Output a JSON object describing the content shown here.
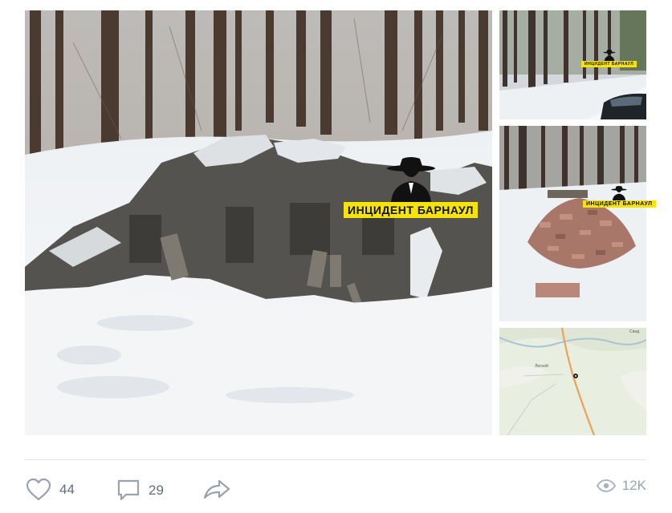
{
  "post": {
    "watermark_text": "ИНЦИДЕНТ БАРНАУЛ",
    "likes": "44",
    "comments": "29",
    "views": "12K"
  },
  "map": {
    "label_top_right": "Санд",
    "label_village": "Лесной"
  },
  "icons": {
    "like": "heart-icon",
    "comment": "comment-bubble-icon",
    "share": "share-arrow-icon",
    "views": "eye-icon"
  },
  "colors": {
    "watermark_bg": "#f5e30a",
    "action_text": "#626d7a",
    "views_text": "#99a2ad"
  }
}
